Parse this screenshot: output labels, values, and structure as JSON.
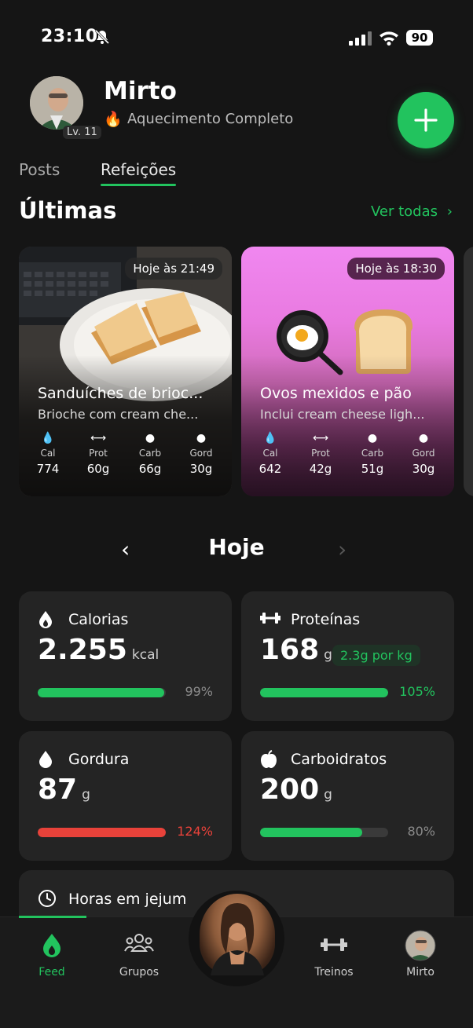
{
  "status_bar": {
    "time": "23:10",
    "battery": "90"
  },
  "header": {
    "user_name": "Mirto",
    "level": "Lv. 11",
    "status_text": "Aquecimento Completo"
  },
  "tabs": [
    {
      "label": "Posts"
    },
    {
      "label": "Refeições"
    }
  ],
  "section": {
    "title": "Últimas",
    "see_all": "Ver todas"
  },
  "meals": [
    {
      "time": "Hoje às 21:49",
      "title": "Sanduíches de brioc...",
      "subtitle": "Brioche com cream che...",
      "macros": [
        {
          "label": "Cal",
          "value": "774"
        },
        {
          "label": "Prot",
          "value": "60g"
        },
        {
          "label": "Carb",
          "value": "66g"
        },
        {
          "label": "Gord",
          "value": "30g"
        }
      ]
    },
    {
      "time": "Hoje às 18:30",
      "title": "Ovos mexidos e pão",
      "subtitle": "Inclui cream cheese ligh...",
      "macros": [
        {
          "label": "Cal",
          "value": "642"
        },
        {
          "label": "Prot",
          "value": "42g"
        },
        {
          "label": "Carb",
          "value": "51g"
        },
        {
          "label": "Gord",
          "value": "30g"
        }
      ]
    }
  ],
  "day": {
    "title": "Hoje"
  },
  "stats": {
    "calorias": {
      "name": "Calorias",
      "value": "2.255",
      "unit": "kcal",
      "percent": "99%",
      "fill_fraction": 0.99,
      "color": "#22c35e"
    },
    "proteinas": {
      "name": "Proteínas",
      "value": "168",
      "unit": "g",
      "percent": "105%",
      "per_kg": "2.3g por kg",
      "fill_fraction": 1.0,
      "color": "#22c35e"
    },
    "gordura": {
      "name": "Gordura",
      "value": "87",
      "unit": "g",
      "percent": "124%",
      "fill_fraction": 1.0,
      "color": "#e8423a"
    },
    "carboidratos": {
      "name": "Carboidratos",
      "value": "200",
      "unit": "g",
      "percent": "80%",
      "fill_fraction": 0.8,
      "color": "#22c35e"
    }
  },
  "fasting": {
    "title": "Horas em jejum"
  },
  "bottom_nav": [
    {
      "label": "Feed"
    },
    {
      "label": "Grupos"
    },
    {
      "label": "Treinos"
    },
    {
      "label": "Mirto"
    }
  ],
  "colors": {
    "accent": "#22c35e",
    "danger": "#e8423a",
    "background": "#151515",
    "card": "#242424"
  }
}
